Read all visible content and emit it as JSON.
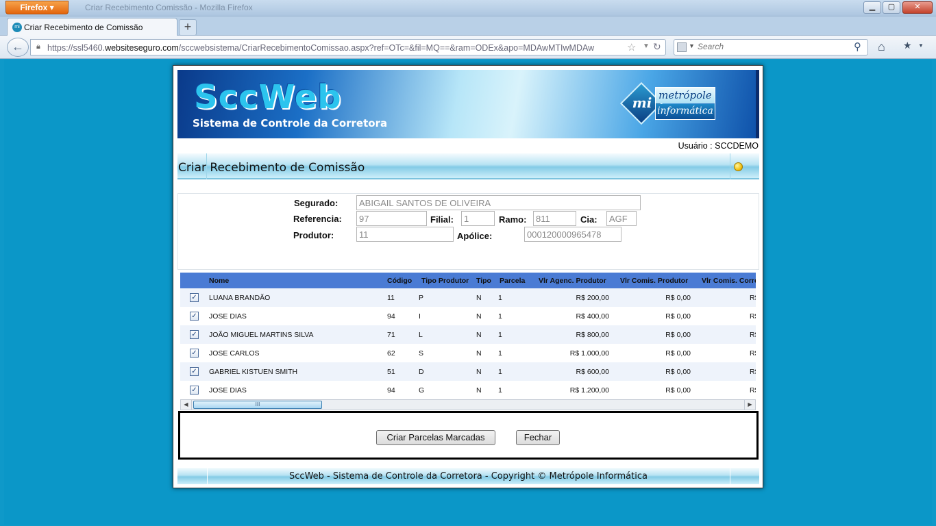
{
  "browser": {
    "app_button": "Firefox",
    "window_caption": "Criar Recebimento Comissão - Mozilla Firefox",
    "tab_title": "Criar Recebimento de Comissão",
    "url_prefix": "https://ssl5460.",
    "url_host": "websiteseguro.com",
    "url_path": "/sccwebsistema/CriarRecebimentoComissao.aspx?ref=OTc=&fil=MQ==&ram=ODEx&apo=MDAwMTIwMDAw",
    "search_placeholder": "Search"
  },
  "banner": {
    "title": "SccWeb",
    "subtitle": "Sistema de Controle da Corretora",
    "logo_mark": "mi",
    "logo_line1": "metrópole",
    "logo_line2": "informática"
  },
  "user_label": "Usuário : SCCDEMO",
  "page_title": "Criar Recebimento de Comissão",
  "form": {
    "segurado_label": "Segurado:",
    "segurado_value": "ABIGAIL SANTOS DE OLIVEIRA",
    "referencia_label": "Referencia:",
    "referencia_value": "97",
    "filial_label": "Filial:",
    "filial_value": "1",
    "ramo_label": "Ramo:",
    "ramo_value": "811",
    "cia_label": "Cia:",
    "cia_value": "AGF",
    "produtor_label": "Produtor:",
    "produtor_value": "11",
    "apolice_label": "Apólice:",
    "apolice_value": "000120000965478"
  },
  "grid": {
    "headers": [
      "Nome",
      "Código",
      "Tipo Produtor",
      "Tipo",
      "Parcela",
      "Vlr Agenc. Produtor",
      "Vlr Comis. Produtor",
      "Vlr Comis. Corretora"
    ],
    "rows": [
      {
        "checked": "✓",
        "nome": "LUANA BRANDÃO",
        "codigo": "11",
        "tipo_produtor": "P",
        "tipo": "N",
        "parcela": "1",
        "vlr_agenc": "R$ 200,00",
        "vlr_comis": "R$ 0,00",
        "vlr_corr": "R$"
      },
      {
        "checked": "✓",
        "nome": "JOSE DIAS",
        "codigo": "94",
        "tipo_produtor": "I",
        "tipo": "N",
        "parcela": "1",
        "vlr_agenc": "R$ 400,00",
        "vlr_comis": "R$ 0,00",
        "vlr_corr": "R$"
      },
      {
        "checked": "✓",
        "nome": "JOÃO MIGUEL MARTINS SILVA",
        "codigo": "71",
        "tipo_produtor": "L",
        "tipo": "N",
        "parcela": "1",
        "vlr_agenc": "R$ 800,00",
        "vlr_comis": "R$ 0,00",
        "vlr_corr": "R$"
      },
      {
        "checked": "✓",
        "nome": "JOSE CARLOS",
        "codigo": "62",
        "tipo_produtor": "S",
        "tipo": "N",
        "parcela": "1",
        "vlr_agenc": "R$ 1.000,00",
        "vlr_comis": "R$ 0,00",
        "vlr_corr": "R$"
      },
      {
        "checked": "✓",
        "nome": "GABRIEL KISTUEN SMITH",
        "codigo": "51",
        "tipo_produtor": "D",
        "tipo": "N",
        "parcela": "1",
        "vlr_agenc": "R$ 600,00",
        "vlr_comis": "R$ 0,00",
        "vlr_corr": "R$"
      },
      {
        "checked": "✓",
        "nome": "JOSE DIAS",
        "codigo": "94",
        "tipo_produtor": "G",
        "tipo": "N",
        "parcela": "1",
        "vlr_agenc": "R$ 1.200,00",
        "vlr_comis": "R$ 0,00",
        "vlr_corr": "R$"
      }
    ],
    "scroll_grip": "III"
  },
  "actions": {
    "create_label": "Criar Parcelas Marcadas",
    "close_label": "Fechar"
  },
  "footer": "SccWeb - Sistema de Controle da Corretora - Copyright © Metrópole Informática",
  "colors": {
    "viewport_bg": "#0f99c9",
    "grid_header": "#4a7bd4",
    "grid_alt_row": "#eef3fb"
  }
}
